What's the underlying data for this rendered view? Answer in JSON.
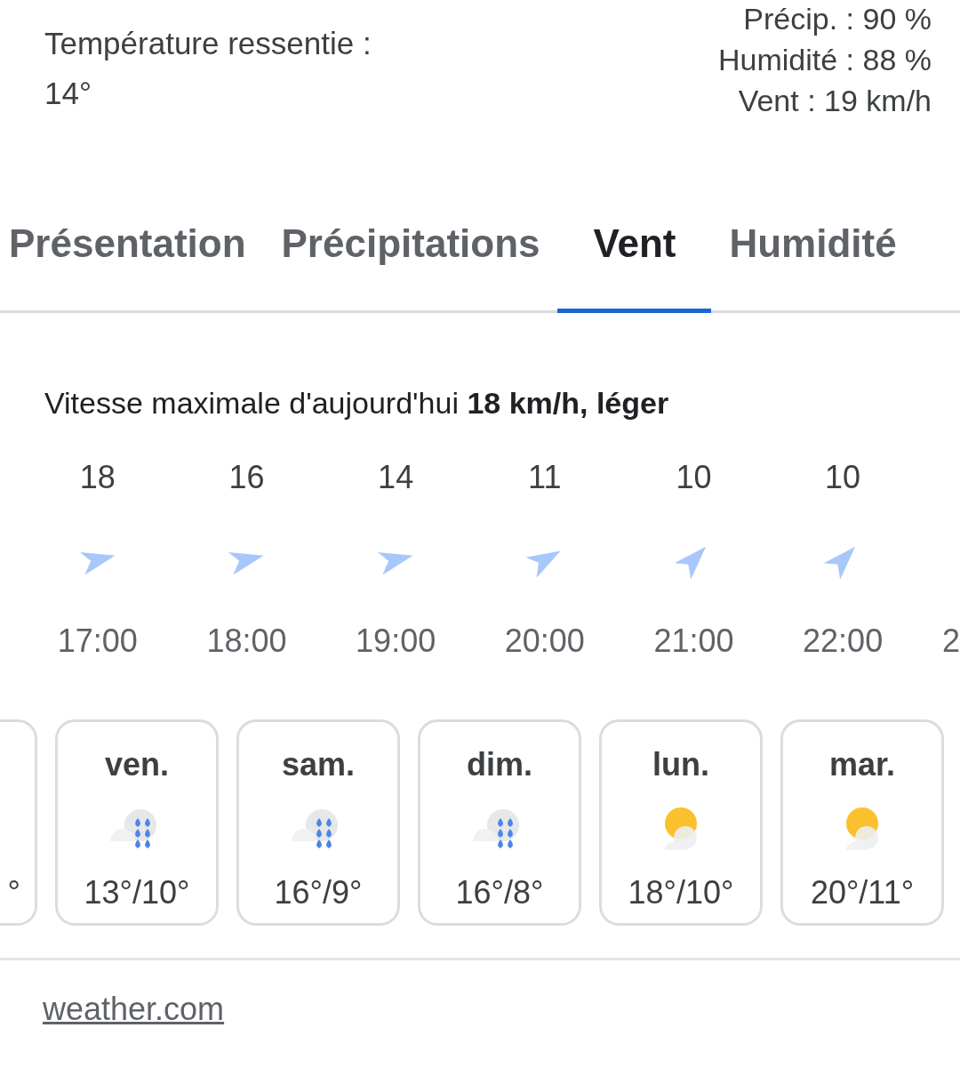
{
  "summary": {
    "feels_like_label": "Température ressentie :",
    "feels_like_value": "14°",
    "stats": [
      "Précip. : 90 %",
      "Humidité : 88 %",
      "Vent : 19 km/h"
    ]
  },
  "tabs": [
    {
      "label": "Présentation",
      "selected": false
    },
    {
      "label": "Précipitations",
      "selected": false
    },
    {
      "label": "Vent",
      "selected": true
    },
    {
      "label": "Humidité",
      "selected": false
    }
  ],
  "wind": {
    "headline": "Vitesse maximale d'aujourd'hui **18 km/h, léger**",
    "hours": [
      {
        "speed": "18",
        "kind": "east",
        "time": "17:00"
      },
      {
        "speed": "16",
        "kind": "east",
        "time": "18:00"
      },
      {
        "speed": "14",
        "kind": "east",
        "time": "19:00"
      },
      {
        "speed": "11",
        "kind": "east-northeast",
        "time": "20:00"
      },
      {
        "speed": "10",
        "kind": "northeast",
        "time": "21:00"
      },
      {
        "speed": "10",
        "kind": "northeast",
        "time": "22:00"
      }
    ],
    "cut_time": "2"
  },
  "days": [
    {
      "kind": "partial",
      "temps": "°"
    },
    {
      "kind": "rain",
      "day": "ven.",
      "temps": "13°/10°"
    },
    {
      "kind": "rain",
      "day": "sam.",
      "temps": "16°/9°"
    },
    {
      "kind": "rain",
      "day": "dim.",
      "temps": "16°/8°"
    },
    {
      "kind": "partly-sunny",
      "day": "lun.",
      "temps": "18°/10°"
    },
    {
      "kind": "partly-sunny",
      "day": "mar.",
      "temps": "20°/11°"
    }
  ],
  "source_link": "weather.com"
}
